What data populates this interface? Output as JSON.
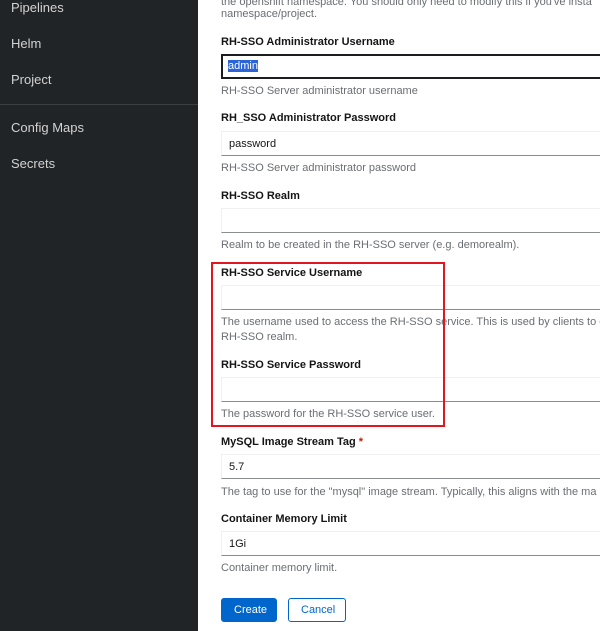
{
  "sidebar": {
    "items": [
      {
        "label": "Pipelines"
      },
      {
        "label": "Helm"
      },
      {
        "label": "Project"
      },
      {
        "label": "Config Maps"
      },
      {
        "label": "Secrets"
      }
    ]
  },
  "form": {
    "top_help_line1": "the openshift namespace. You should only need to modify this if you've insta",
    "top_help_line2": "namespace/project.",
    "admin_username": {
      "label": "RH-SSO Administrator Username",
      "value": "admin",
      "help": "RH-SSO Server administrator username"
    },
    "admin_password": {
      "label": "RH_SSO Administrator Password",
      "value": "password",
      "help": "RH-SSO Server administrator password"
    },
    "realm": {
      "label": "RH-SSO Realm",
      "value": "",
      "help": "Realm to be created in the RH-SSO server (e.g. demorealm)."
    },
    "service_username": {
      "label": "RH-SSO Service Username",
      "value": "",
      "help_line1": "The username used to access the RH-SSO service. This is used by clients to c",
      "help_line2": "RH-SSO realm."
    },
    "service_password": {
      "label": "RH-SSO Service Password",
      "value": "",
      "help": "The password for the RH-SSO service user."
    },
    "mysql_tag": {
      "label": "MySQL Image Stream Tag",
      "required_mark": "*",
      "value": "5.7",
      "help": "The tag to use for the \"mysql\" image stream. Typically, this aligns with the ma"
    },
    "memory_limit": {
      "label": "Container Memory Limit",
      "value": "1Gi",
      "help": "Container memory limit."
    }
  },
  "actions": {
    "create_label": "Create",
    "cancel_label": "Cancel"
  },
  "colors": {
    "sidebar_bg": "#212427",
    "primary": "#0066cc",
    "highlight": "#e1161e"
  }
}
